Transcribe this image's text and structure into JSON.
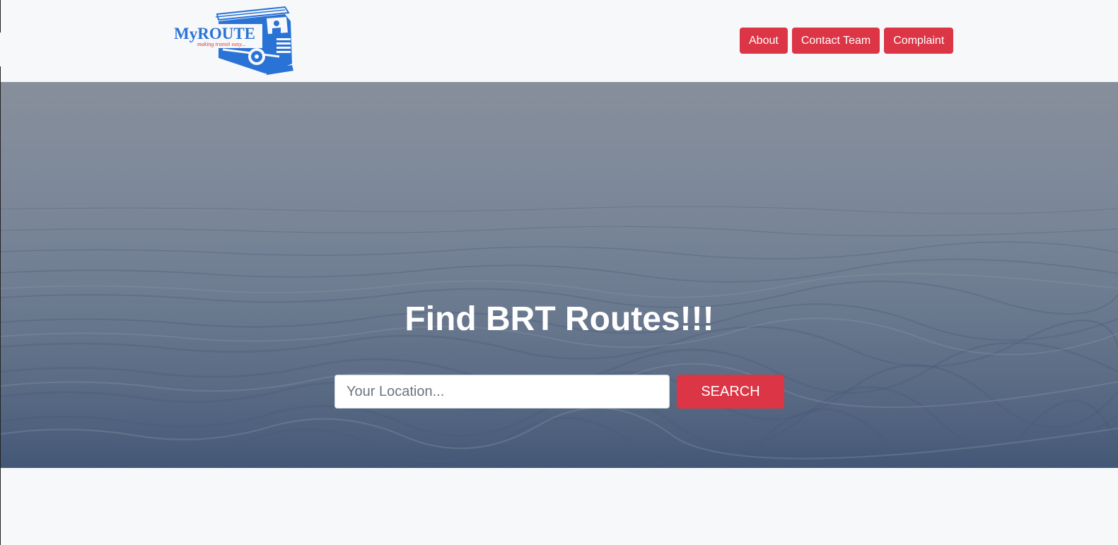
{
  "brand": {
    "logo_text": "MyROUTE",
    "tagline": "making transit easy...",
    "logo_color": "#2a73d6",
    "tagline_color": "#e03131"
  },
  "nav": {
    "items": [
      {
        "label": "About"
      },
      {
        "label": "Contact Team"
      },
      {
        "label": "Complaint"
      }
    ]
  },
  "hero": {
    "title": "Find BRT Routes!!!",
    "search": {
      "placeholder": "Your Location...",
      "value": "",
      "button_label": "SEARCH"
    }
  },
  "colors": {
    "accent": "#dc3545",
    "background": "#f7f8fa",
    "hero_water": "#5f6f86"
  }
}
